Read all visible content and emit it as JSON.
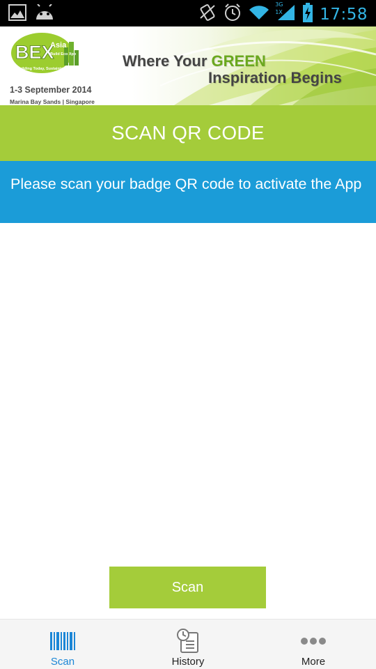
{
  "status_bar": {
    "time": "17:58",
    "network": "3G",
    "signal_sub": "1X"
  },
  "banner": {
    "logo_text": "BEX",
    "logo_sub": "Asia",
    "logo_event": "Build Eco Xpo",
    "logo_slogan": "Building Today, Sustaining Tomorrow",
    "dates": "1-3 September 2014",
    "venue": "Marina Bay Sands | Singapore",
    "tagline_part1": "Where Your ",
    "tagline_highlight": "GREEN",
    "tagline_part2": "Inspiration Begins"
  },
  "header": {
    "title": "SCAN QR CODE"
  },
  "info": {
    "message": "Please scan your badge QR code to activate the App"
  },
  "main": {
    "scan_button_label": "Scan"
  },
  "bottom_nav": {
    "items": [
      {
        "label": "Scan",
        "icon": "barcode-icon"
      },
      {
        "label": "History",
        "icon": "history-icon"
      },
      {
        "label": "More",
        "icon": "more-dots-icon"
      }
    ]
  },
  "colors": {
    "status_bar_bg": "#000000",
    "accent_blue": "#33b5e5",
    "header_green": "#a4cc3a",
    "info_blue": "#1b9cd8",
    "nav_active": "#1b86d6"
  }
}
